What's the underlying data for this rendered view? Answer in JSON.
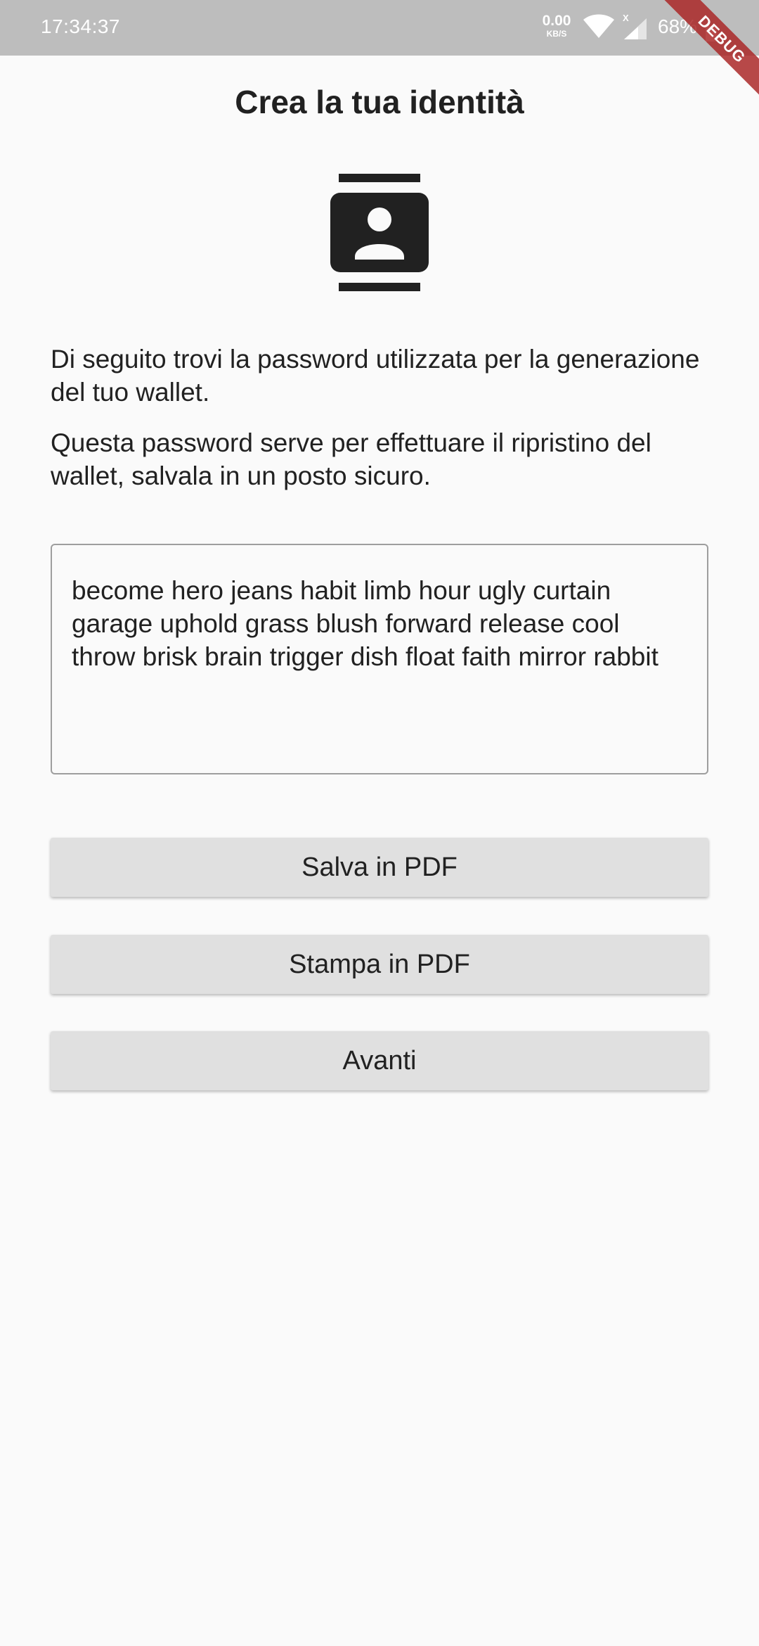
{
  "status_bar": {
    "time": "17:34:37",
    "speed_value": "0.00",
    "speed_unit": "KB/S",
    "signal_badge": "X",
    "battery": "68%"
  },
  "debug_banner": "DEBUG",
  "header": {
    "title": "Crea la tua identità"
  },
  "icon": "contact-card-icon",
  "intro": {
    "paragraph1": "Di seguito trovi la password utilizzata per la generazione del tuo wallet.",
    "paragraph2": "Questa password serve per effettuare il ripristino del wallet, salvala in un posto sicuro."
  },
  "password": {
    "value": "become hero jeans habit limb hour ugly curtain garage uphold grass blush forward release cool throw brisk brain trigger dish float faith mirror rabbit"
  },
  "actions": {
    "save_label": "Salva in PDF",
    "print_label": "Stampa in PDF",
    "next_label": "Avanti"
  },
  "colors": {
    "status_bar": "#bdbdbd",
    "background": "#fafafa",
    "button": "#e0e0e0",
    "text": "#212121",
    "debug_ribbon": "#aa2828"
  }
}
